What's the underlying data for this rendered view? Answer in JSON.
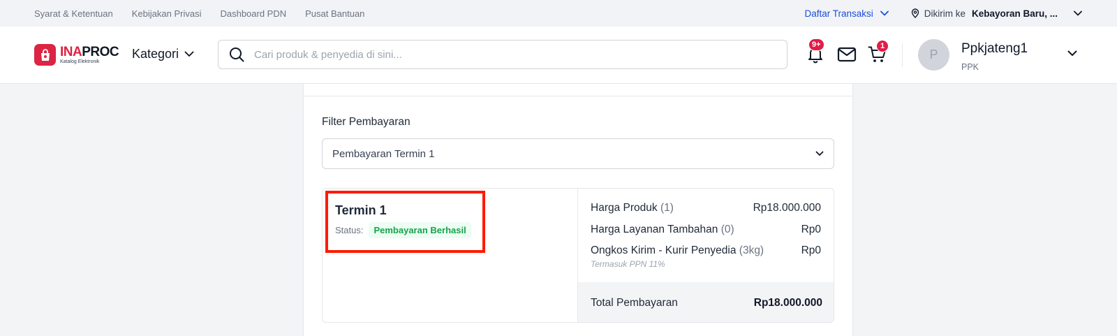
{
  "topbar": {
    "links": [
      "Syarat & Ketentuan",
      "Kebijakan Privasi",
      "Dashboard PDN",
      "Pusat Bantuan"
    ],
    "transactions_label": "Daftar Transaksi",
    "ship_to_label": "Dikirim ke",
    "ship_to_value": "Kebayoran Baru, ..."
  },
  "header": {
    "logo_ina": "INA",
    "logo_proc": "PROC",
    "logo_sub": "Katalog Elektronik",
    "category_label": "Kategori",
    "search_placeholder": "Cari produk & penyedia di sini...",
    "notif_badge": "9+",
    "cart_badge": "1",
    "avatar_initial": "P",
    "user_name": "Ppkjateng1",
    "user_role": "PPK"
  },
  "filter": {
    "label": "Filter Pembayaran",
    "selected": "Pembayaran Termin 1"
  },
  "payment": {
    "termin_title": "Termin 1",
    "status_label": "Status:",
    "status_value": "Pembayaran Berhasil",
    "lines": [
      {
        "label": "Harga Produk",
        "count": "(1)",
        "value": "Rp18.000.000"
      },
      {
        "label": "Harga Layanan Tambahan",
        "count": "(0)",
        "value": "Rp0"
      },
      {
        "label": "Ongkos Kirim - Kurir Penyedia",
        "count": "(3kg)",
        "value": "Rp0"
      }
    ],
    "tax_note": "Termasuk PPN 11%",
    "total_label": "Total Pembayaran",
    "total_value": "Rp18.000.000"
  },
  "colors": {
    "brand_red": "#dc2443",
    "link_blue": "#1d4ed8",
    "success_green": "#16a34a",
    "highlight_red": "#ff1a00"
  }
}
